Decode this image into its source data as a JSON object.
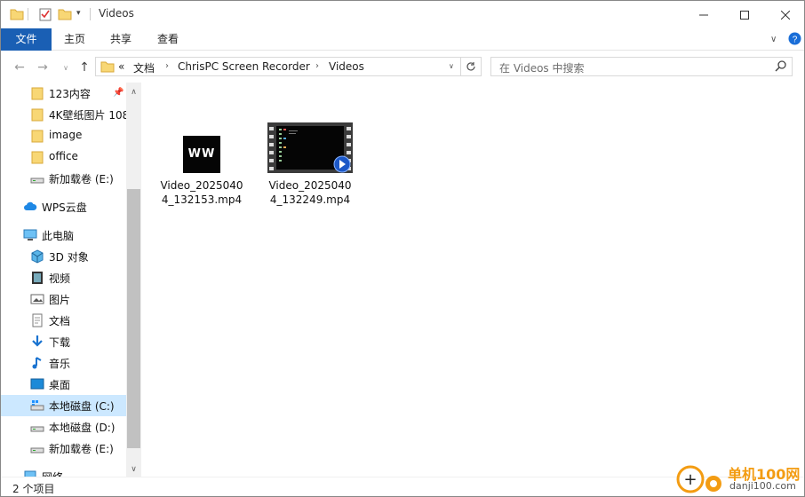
{
  "window": {
    "title": "Videos"
  },
  "ribbon": {
    "tabs": [
      "文件",
      "主页",
      "共享",
      "查看"
    ]
  },
  "address": {
    "overflow": "«",
    "crumbs": [
      "文档",
      "ChrisPC Screen Recorder",
      "Videos"
    ]
  },
  "search": {
    "placeholder": "在 Videos 中搜索"
  },
  "sidebar": {
    "items": [
      {
        "label": "123内容",
        "icon": "folder-icon"
      },
      {
        "label": "4K壁纸图片 108",
        "icon": "folder-icon"
      },
      {
        "label": "image",
        "icon": "folder-icon"
      },
      {
        "label": "office",
        "icon": "folder-icon"
      },
      {
        "label": "新加载卷 (E:)",
        "icon": "drive-icon"
      },
      {
        "label": "WPS云盘",
        "icon": "cloud-icon"
      },
      {
        "label": "此电脑",
        "icon": "computer-icon"
      },
      {
        "label": "3D 对象",
        "icon": "3d-objects-icon"
      },
      {
        "label": "视频",
        "icon": "video-folder-icon"
      },
      {
        "label": "图片",
        "icon": "pictures-icon"
      },
      {
        "label": "文档",
        "icon": "documents-icon"
      },
      {
        "label": "下载",
        "icon": "download-icon"
      },
      {
        "label": "音乐",
        "icon": "music-icon"
      },
      {
        "label": "桌面",
        "icon": "desktop-icon"
      },
      {
        "label": "本地磁盘 (C:)",
        "icon": "drive-icon"
      },
      {
        "label": "本地磁盘 (D:)",
        "icon": "drive-icon"
      },
      {
        "label": "新加载卷 (E:)",
        "icon": "drive-icon"
      },
      {
        "label": "网络",
        "icon": "network-icon"
      }
    ],
    "selected": "本地磁盘 (C:)"
  },
  "files": [
    {
      "name": "Video_20250404_132153.mp4",
      "thumb_text": "WW"
    },
    {
      "name": "Video_20250404_132249.mp4"
    }
  ],
  "status": {
    "count": "2 个项目"
  },
  "watermark": {
    "text": "单机100网",
    "sub": "danji100.com"
  },
  "colors": {
    "accent": "#1a5fb4",
    "selection": "#cce8ff",
    "folder": "#f8d775"
  }
}
